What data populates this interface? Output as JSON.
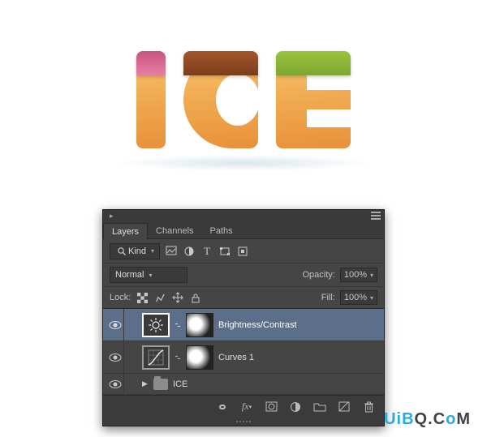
{
  "artwork": {
    "text": "ICE"
  },
  "panel": {
    "tabs": [
      "Layers",
      "Channels",
      "Paths"
    ],
    "activeTab": 0,
    "filter": {
      "kind_label": "Kind"
    },
    "blend": {
      "mode": "Normal",
      "opacity_label": "Opacity:",
      "opacity_value": "100%"
    },
    "lock": {
      "label": "Lock:",
      "fill_label": "Fill:",
      "fill_value": "100%"
    },
    "layers": [
      {
        "kind": "adjustment",
        "name": "Brightness/Contrast",
        "selected": true,
        "icon": "brightness"
      },
      {
        "kind": "adjustment",
        "name": "Curves 1",
        "selected": false,
        "icon": "curves"
      },
      {
        "kind": "group",
        "name": "ICE",
        "selected": false
      }
    ]
  },
  "watermark": {
    "a": "UiB",
    "b": "Q.C",
    "c": "o",
    "d": "M"
  }
}
